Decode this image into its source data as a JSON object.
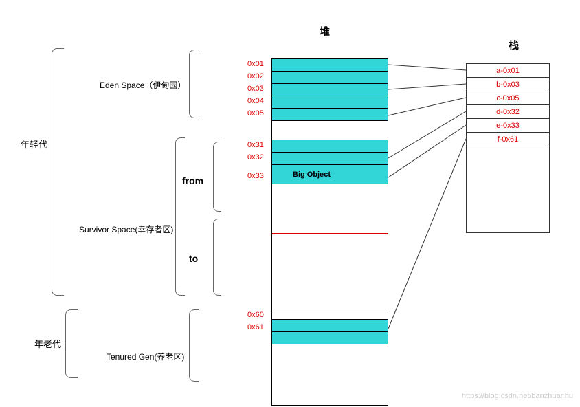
{
  "titles": {
    "heap": "堆",
    "stack": "栈"
  },
  "generations": {
    "young": "年轻代",
    "old": "年老代"
  },
  "spaces": {
    "eden": "Eden Space（伊甸园）",
    "survivor": "Survivor Space(幸存者区)",
    "from": "from",
    "to": "to",
    "tenured": "Tenured Gen(养老区)"
  },
  "heap_addrs": {
    "a1": "0x01",
    "a2": "0x02",
    "a3": "0x03",
    "a4": "0x04",
    "a5": "0x05",
    "b1": "0x31",
    "b2": "0x32",
    "b3": "0x33",
    "c1": "0x60",
    "c2": "0x61"
  },
  "big_object": "Big Object",
  "stack_cells": {
    "s0": "a-0x01",
    "s1": "b-0x03",
    "s2": "c-0x05",
    "s3": "d-0x32",
    "s4": "e-0x33",
    "s5": "f-0x61"
  },
  "watermark": "https://blog.csdn.net/banzhuanhu"
}
